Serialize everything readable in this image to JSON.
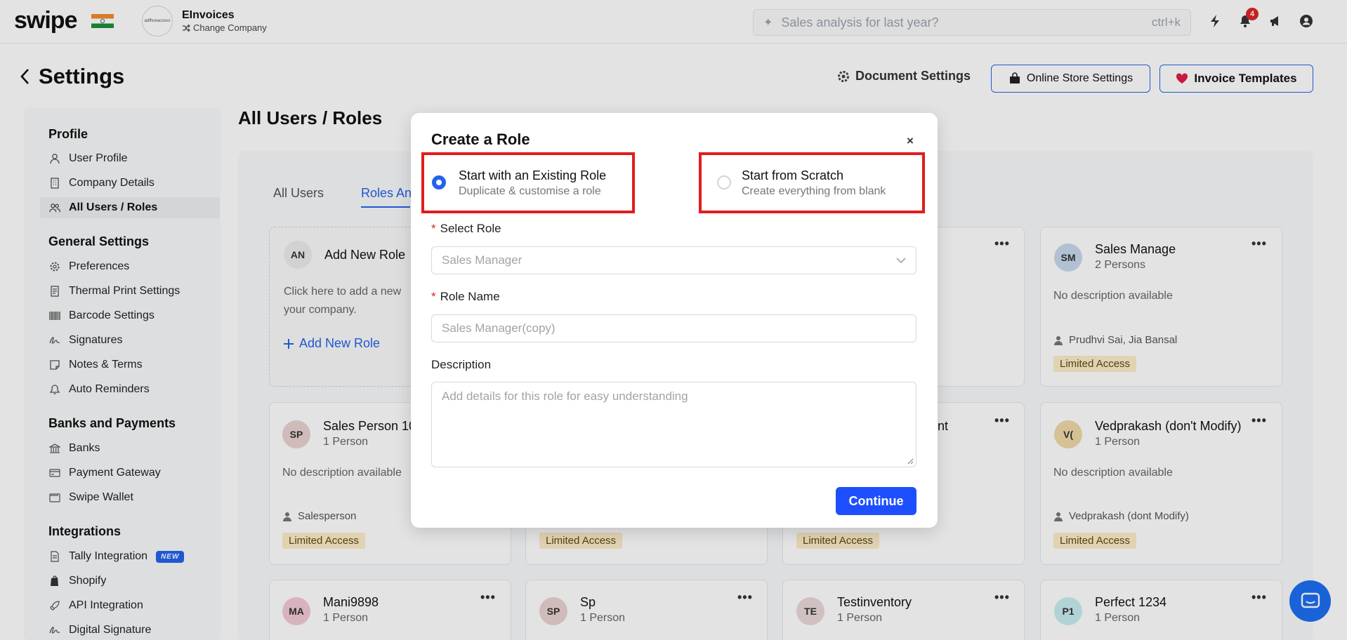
{
  "topbar": {
    "logo": "swipe",
    "company_logo_text": "adffsreaccess",
    "company_name": "EInvoices",
    "change_company": "Change Company",
    "search_placeholder": "Sales analysis for last year?",
    "search_shortcut": "ctrl+k",
    "notification_count": "4"
  },
  "header": {
    "title": "Settings",
    "document_settings": "Document Settings",
    "online_store_settings": "Online Store Settings",
    "invoice_templates": "Invoice Templates"
  },
  "sidebar": {
    "sections": [
      {
        "heading": "Profile",
        "items": [
          "User Profile",
          "Company Details",
          "All Users / Roles"
        ]
      },
      {
        "heading": "General Settings",
        "items": [
          "Preferences",
          "Thermal Print Settings",
          "Barcode Settings",
          "Signatures",
          "Notes & Terms",
          "Auto Reminders"
        ]
      },
      {
        "heading": "Banks and Payments",
        "items": [
          "Banks",
          "Payment Gateway",
          "Swipe Wallet"
        ]
      },
      {
        "heading": "Integrations",
        "items": [
          "Tally Integration",
          "Shopify",
          "API Integration",
          "Digital Signature"
        ]
      }
    ],
    "new_badge": "NEW",
    "active_item": "All Users / Roles"
  },
  "main": {
    "title": "All Users / Roles",
    "tabs": [
      "All Users",
      "Roles An"
    ],
    "add_card": {
      "avatar": "AN",
      "title": "Add New Role",
      "desc_line1": "Click here to add a new",
      "desc_line2": "your company.",
      "link": "Add New Role"
    },
    "cards": [
      {
        "initials": "SM",
        "name": "Sales Manage",
        "persons": "2 Persons",
        "desc": "No description available",
        "members": "Prudhvi Sai, Jia Bansal",
        "access": "Limited Access",
        "color": "#c7d9ee"
      },
      {
        "initials": "SP",
        "name": "Sales Person 10",
        "persons": "1 Person",
        "desc": "No description available",
        "members": "Salesperson",
        "access": "Limited Access",
        "color": "#ead2d2"
      },
      {
        "name_fragment": "nt",
        "access": "Limited Access"
      },
      {
        "access": "Limited Access"
      },
      {
        "initials": "V(",
        "name": "Vedprakash (don't Modify)",
        "persons": "1 Person",
        "desc": "No description available",
        "members": "Vedprakash (dont Modify)",
        "access": "Limited Access",
        "color": "#f0d9a8"
      },
      {
        "initials": "MA",
        "name": "Mani9898",
        "persons": "1 Person",
        "color": "#f3c9d6"
      },
      {
        "initials": "SP",
        "name": "Sp",
        "persons": "1 Person",
        "color": "#ead2d2"
      },
      {
        "initials": "TE",
        "name": "Testinventory",
        "persons": "1 Person",
        "color": "#ead8d8"
      },
      {
        "initials": "P1",
        "name": "Perfect 1234",
        "persons": "1 Person",
        "color": "#c7eef0"
      }
    ],
    "more_dots": "•••"
  },
  "modal": {
    "title": "Create a Role",
    "close": "×",
    "option_existing": {
      "title": "Start with an Existing Role",
      "subtitle": "Duplicate & customise a role"
    },
    "option_scratch": {
      "title": "Start from Scratch",
      "subtitle": "Create everything from blank"
    },
    "select_role_label": "Select Role",
    "select_role_value": "Sales Manager",
    "role_name_label": "Role Name",
    "role_name_placeholder": "Sales Manager(copy)",
    "description_label": "Description",
    "description_placeholder": "Add details for this role for easy understanding",
    "continue": "Continue",
    "highlight_color": "#e11d1d",
    "accent_color": "#1e4fff"
  }
}
